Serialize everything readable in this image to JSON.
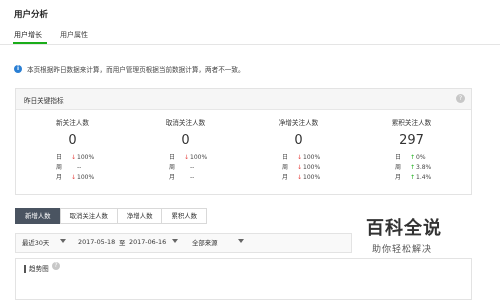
{
  "page": {
    "title": "用户分析"
  },
  "tabs": [
    {
      "label": "用户增长"
    },
    {
      "label": "用户属性"
    }
  ],
  "notice": {
    "icon": "info-icon",
    "text": "本页根据昨日数据来计算，而用户管理页根据当前数据计算，两者不一致。"
  },
  "panel": {
    "title": "昨日关键指标",
    "metrics": [
      {
        "label": "新关注人数",
        "value": "0",
        "rows": [
          {
            "label": "日",
            "dir": "down",
            "value": "100%"
          },
          {
            "label": "周",
            "dir": "none",
            "value": "--"
          },
          {
            "label": "月",
            "dir": "down",
            "value": "100%"
          }
        ]
      },
      {
        "label": "取消关注人数",
        "value": "0",
        "rows": [
          {
            "label": "日",
            "dir": "down",
            "value": "100%"
          },
          {
            "label": "周",
            "dir": "none",
            "value": "--"
          },
          {
            "label": "月",
            "dir": "none",
            "value": "--"
          }
        ]
      },
      {
        "label": "净增关注人数",
        "value": "0",
        "rows": [
          {
            "label": "日",
            "dir": "down",
            "value": "100%"
          },
          {
            "label": "周",
            "dir": "down",
            "value": "100%"
          },
          {
            "label": "月",
            "dir": "down",
            "value": "100%"
          }
        ]
      },
      {
        "label": "累积关注人数",
        "value": "297",
        "rows": [
          {
            "label": "日",
            "dir": "up",
            "value": "0%"
          },
          {
            "label": "周",
            "dir": "up",
            "value": "3.8%"
          },
          {
            "label": "月",
            "dir": "up",
            "value": "1.4%"
          }
        ]
      }
    ],
    "colors": {
      "up": "#1aad19",
      "down": "#e64340"
    }
  },
  "segments": [
    {
      "label": "新增人数"
    },
    {
      "label": "取消关注人数"
    },
    {
      "label": "净增人数"
    },
    {
      "label": "累积人数"
    }
  ],
  "filters": {
    "period": "最近30天",
    "start": "2017-05-18",
    "separator": "至",
    "end": "2017-06-16",
    "source": "全部来源"
  },
  "watermark": {
    "title": "百科全说",
    "subtitle": "助你轻松解决"
  },
  "trend": {
    "title": "趋势图"
  }
}
